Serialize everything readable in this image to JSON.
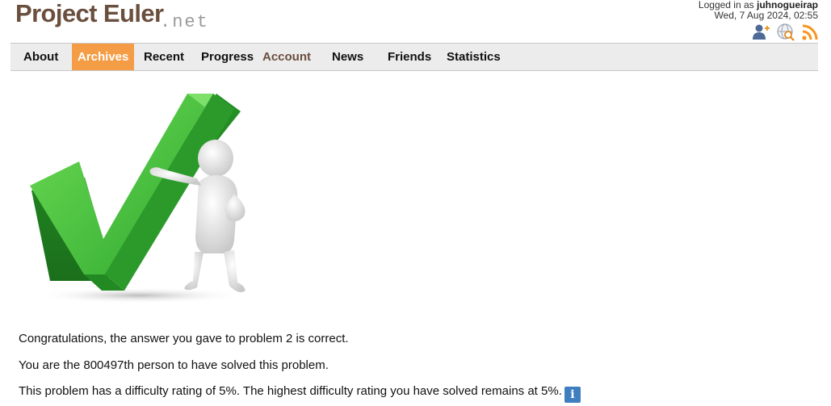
{
  "header": {
    "logo_main": "Project Euler",
    "logo_suffix": ".net",
    "login_prefix": "Logged in as",
    "username": "juhnogueirap",
    "datetime": "Wed, 7 Aug 2024, 02:55",
    "icons": [
      "add-friend-icon",
      "search-globe-icon",
      "rss-icon"
    ]
  },
  "nav": {
    "items": [
      {
        "label": "About"
      },
      {
        "label": "Archives",
        "active": true
      },
      {
        "label": "Recent"
      },
      {
        "label": "Progress"
      },
      {
        "label": "Account"
      },
      {
        "label": "News"
      },
      {
        "label": "Friends"
      },
      {
        "label": "Statistics"
      }
    ]
  },
  "content": {
    "hero_image": "green-checkmark-with-figure",
    "congrats": "Congratulations, the answer you gave to problem 2 is correct.",
    "solver_count": "You are the 800497th person to have solved this problem.",
    "difficulty": "This problem has a difficulty rating of 5%. The highest difficulty rating you have solved remains at 5%.",
    "info_glyph": "i"
  },
  "colors": {
    "brand_brown": "#6b4f3e",
    "nav_active": "#f59d46",
    "nav_bg": "#ececec",
    "check_green": "#3cb43c",
    "rss_orange": "#f7941d",
    "info_blue": "#3f7fc0"
  }
}
